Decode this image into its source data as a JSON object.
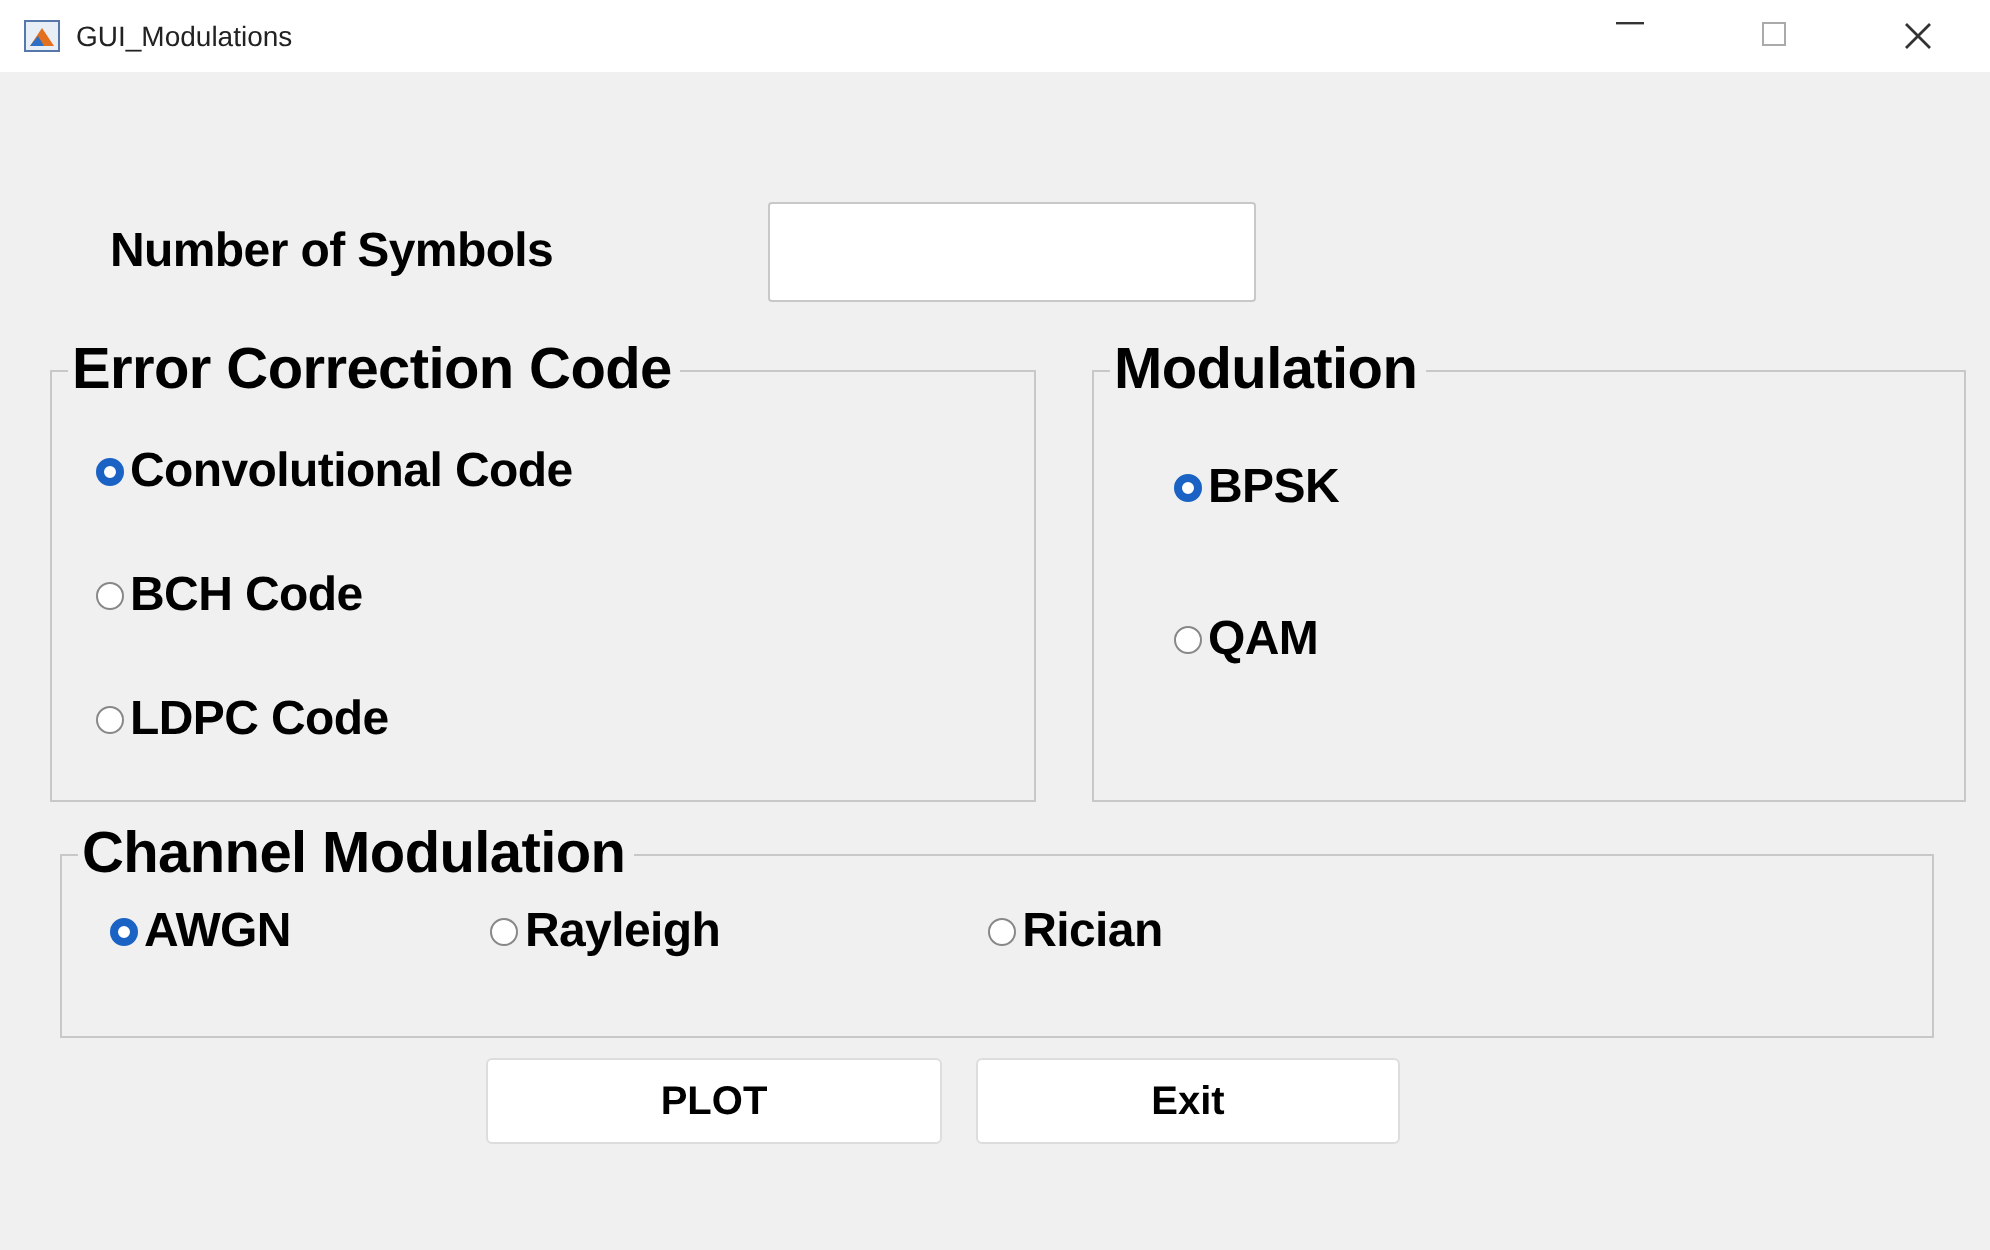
{
  "window": {
    "title": "GUI_Modulations"
  },
  "symbols": {
    "label": "Number of Symbols"
  },
  "panels": [
    {
      "title": "Error Correction Code",
      "kind": "column",
      "options": [
        {
          "label": "Convolutional Code",
          "selected": true
        },
        {
          "label": "BCH Code",
          "selected": false
        },
        {
          "label": "LDPC Code",
          "selected": false
        }
      ]
    },
    {
      "title": "Modulation",
      "kind": "column",
      "options": [
        {
          "label": "BPSK",
          "selected": true
        },
        {
          "label": "QAM",
          "selected": false
        }
      ]
    },
    {
      "title": "Channel Modulation",
      "kind": "row",
      "options": [
        {
          "label": "AWGN",
          "selected": true
        },
        {
          "label": "Rayleigh",
          "selected": false
        },
        {
          "label": "Rician",
          "selected": false
        }
      ]
    }
  ],
  "buttons": [
    "PLOT",
    "Exit"
  ]
}
